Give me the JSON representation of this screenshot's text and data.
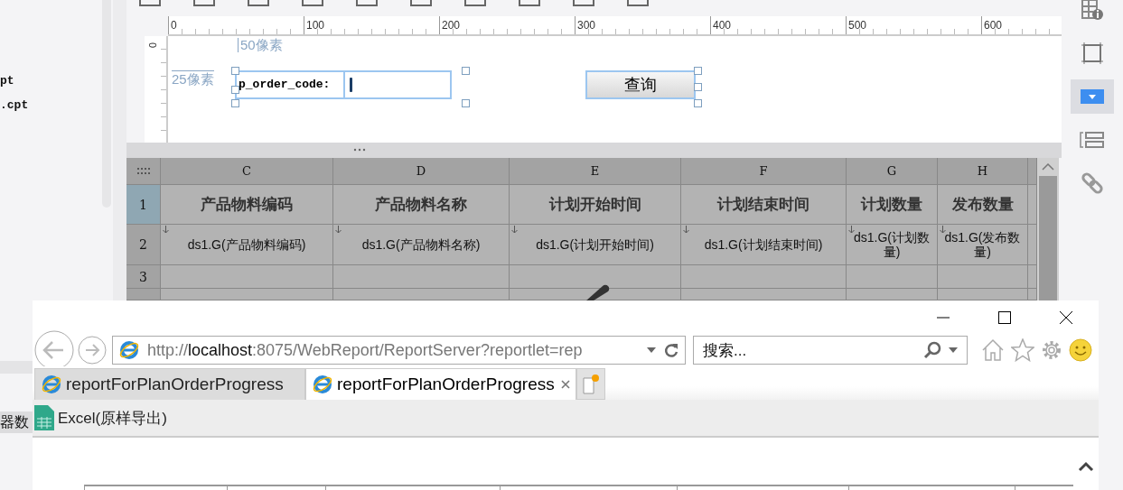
{
  "designer": {
    "file_list": [
      {
        "name": "pt"
      },
      {
        "name": ".cpt"
      }
    ],
    "ruler": {
      "x_labels": [
        "0",
        "100",
        "200",
        "300",
        "400",
        "500",
        "600"
      ],
      "y_labels": [
        "0"
      ]
    },
    "canvas": {
      "width_hint": "50像素",
      "height_hint": "25像素",
      "param_label": "p_order_code:",
      "query_button": "查询"
    },
    "grid": {
      "columns": [
        "C",
        "D",
        "E",
        "F",
        "G",
        "H"
      ],
      "rows": [
        {
          "number": "1",
          "selected": true,
          "cells": [
            {
              "text": "产品物料编码",
              "expand_down": false
            },
            {
              "text": "产品物料名称",
              "expand_down": false
            },
            {
              "text": "计划开始时间",
              "expand_down": false
            },
            {
              "text": "计划结束时间",
              "expand_down": false
            },
            {
              "text": "计划数量",
              "expand_down": false
            },
            {
              "text": "发布数量",
              "expand_down": false
            }
          ]
        },
        {
          "number": "2",
          "selected": false,
          "cells": [
            {
              "text": "ds1.G(产品物料编码)",
              "expand_down": true
            },
            {
              "text": "ds1.G(产品物料名称)",
              "expand_down": true
            },
            {
              "text": "ds1.G(计划开始时间)",
              "expand_down": true
            },
            {
              "text": "ds1.G(计划结束时间)",
              "expand_down": true
            },
            {
              "text": "ds1.G(计划数量)",
              "expand_down": true
            },
            {
              "text": "ds1.G(发布数量)",
              "expand_down": true
            }
          ]
        },
        {
          "number": "3",
          "selected": false
        },
        {
          "selected": false
        }
      ]
    },
    "side_label": "器数",
    "sidebar": [
      {
        "kind": "info",
        "selected": false
      },
      {
        "kind": "frame",
        "selected": false
      },
      {
        "kind": "dropdown",
        "selected": true
      },
      {
        "kind": "list",
        "selected": false
      },
      {
        "kind": "link",
        "selected": false
      }
    ]
  },
  "browser": {
    "address": {
      "scheme": "http://",
      "host": "localhost",
      "rest": ":8075/WebReport/ReportServer?reportlet=rep"
    },
    "search": {
      "placeholder": "搜索..."
    },
    "tabs": [
      {
        "title": "reportForPlanOrderProgress",
        "selected": false
      },
      {
        "title": "reportForPlanOrderProgress",
        "selected": true
      }
    ],
    "commands": [
      {
        "label": "Excel(原样导出)"
      }
    ]
  }
}
